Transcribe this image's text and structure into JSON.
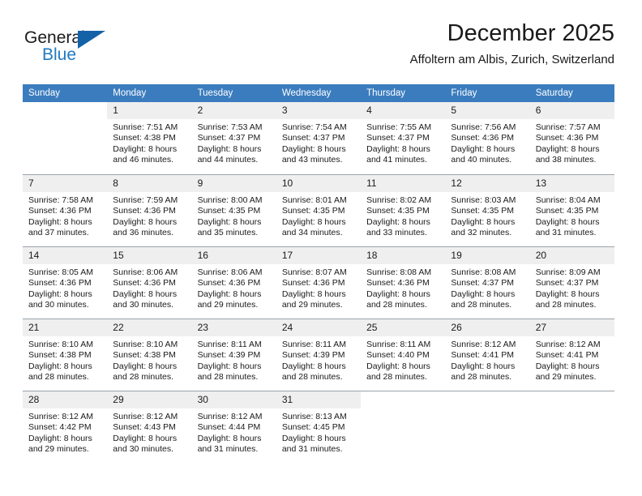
{
  "brand": {
    "name_top": "General",
    "name_bottom": "Blue",
    "triangle_color": "#1362a8",
    "blue_color": "#1f7ac0"
  },
  "header": {
    "month_title": "December 2025",
    "location": "Affoltern am Albis, Zurich, Switzerland"
  },
  "theme": {
    "header_row_bg": "#3b7cbe",
    "daynum_bg": "#efefef",
    "grid_line": "#9aa3ab",
    "text": "#1a1a1a"
  },
  "calendar": {
    "weekday_headers": [
      "Sunday",
      "Monday",
      "Tuesday",
      "Wednesday",
      "Thursday",
      "Friday",
      "Saturday"
    ],
    "weeks": [
      [
        {
          "day": "",
          "sunrise": "",
          "sunset": "",
          "daylight_line1": "",
          "daylight_line2": ""
        },
        {
          "day": "1",
          "sunrise": "Sunrise: 7:51 AM",
          "sunset": "Sunset: 4:38 PM",
          "daylight_line1": "Daylight: 8 hours",
          "daylight_line2": "and 46 minutes."
        },
        {
          "day": "2",
          "sunrise": "Sunrise: 7:53 AM",
          "sunset": "Sunset: 4:37 PM",
          "daylight_line1": "Daylight: 8 hours",
          "daylight_line2": "and 44 minutes."
        },
        {
          "day": "3",
          "sunrise": "Sunrise: 7:54 AM",
          "sunset": "Sunset: 4:37 PM",
          "daylight_line1": "Daylight: 8 hours",
          "daylight_line2": "and 43 minutes."
        },
        {
          "day": "4",
          "sunrise": "Sunrise: 7:55 AM",
          "sunset": "Sunset: 4:37 PM",
          "daylight_line1": "Daylight: 8 hours",
          "daylight_line2": "and 41 minutes."
        },
        {
          "day": "5",
          "sunrise": "Sunrise: 7:56 AM",
          "sunset": "Sunset: 4:36 PM",
          "daylight_line1": "Daylight: 8 hours",
          "daylight_line2": "and 40 minutes."
        },
        {
          "day": "6",
          "sunrise": "Sunrise: 7:57 AM",
          "sunset": "Sunset: 4:36 PM",
          "daylight_line1": "Daylight: 8 hours",
          "daylight_line2": "and 38 minutes."
        }
      ],
      [
        {
          "day": "7",
          "sunrise": "Sunrise: 7:58 AM",
          "sunset": "Sunset: 4:36 PM",
          "daylight_line1": "Daylight: 8 hours",
          "daylight_line2": "and 37 minutes."
        },
        {
          "day": "8",
          "sunrise": "Sunrise: 7:59 AM",
          "sunset": "Sunset: 4:36 PM",
          "daylight_line1": "Daylight: 8 hours",
          "daylight_line2": "and 36 minutes."
        },
        {
          "day": "9",
          "sunrise": "Sunrise: 8:00 AM",
          "sunset": "Sunset: 4:35 PM",
          "daylight_line1": "Daylight: 8 hours",
          "daylight_line2": "and 35 minutes."
        },
        {
          "day": "10",
          "sunrise": "Sunrise: 8:01 AM",
          "sunset": "Sunset: 4:35 PM",
          "daylight_line1": "Daylight: 8 hours",
          "daylight_line2": "and 34 minutes."
        },
        {
          "day": "11",
          "sunrise": "Sunrise: 8:02 AM",
          "sunset": "Sunset: 4:35 PM",
          "daylight_line1": "Daylight: 8 hours",
          "daylight_line2": "and 33 minutes."
        },
        {
          "day": "12",
          "sunrise": "Sunrise: 8:03 AM",
          "sunset": "Sunset: 4:35 PM",
          "daylight_line1": "Daylight: 8 hours",
          "daylight_line2": "and 32 minutes."
        },
        {
          "day": "13",
          "sunrise": "Sunrise: 8:04 AM",
          "sunset": "Sunset: 4:35 PM",
          "daylight_line1": "Daylight: 8 hours",
          "daylight_line2": "and 31 minutes."
        }
      ],
      [
        {
          "day": "14",
          "sunrise": "Sunrise: 8:05 AM",
          "sunset": "Sunset: 4:36 PM",
          "daylight_line1": "Daylight: 8 hours",
          "daylight_line2": "and 30 minutes."
        },
        {
          "day": "15",
          "sunrise": "Sunrise: 8:06 AM",
          "sunset": "Sunset: 4:36 PM",
          "daylight_line1": "Daylight: 8 hours",
          "daylight_line2": "and 30 minutes."
        },
        {
          "day": "16",
          "sunrise": "Sunrise: 8:06 AM",
          "sunset": "Sunset: 4:36 PM",
          "daylight_line1": "Daylight: 8 hours",
          "daylight_line2": "and 29 minutes."
        },
        {
          "day": "17",
          "sunrise": "Sunrise: 8:07 AM",
          "sunset": "Sunset: 4:36 PM",
          "daylight_line1": "Daylight: 8 hours",
          "daylight_line2": "and 29 minutes."
        },
        {
          "day": "18",
          "sunrise": "Sunrise: 8:08 AM",
          "sunset": "Sunset: 4:36 PM",
          "daylight_line1": "Daylight: 8 hours",
          "daylight_line2": "and 28 minutes."
        },
        {
          "day": "19",
          "sunrise": "Sunrise: 8:08 AM",
          "sunset": "Sunset: 4:37 PM",
          "daylight_line1": "Daylight: 8 hours",
          "daylight_line2": "and 28 minutes."
        },
        {
          "day": "20",
          "sunrise": "Sunrise: 8:09 AM",
          "sunset": "Sunset: 4:37 PM",
          "daylight_line1": "Daylight: 8 hours",
          "daylight_line2": "and 28 minutes."
        }
      ],
      [
        {
          "day": "21",
          "sunrise": "Sunrise: 8:10 AM",
          "sunset": "Sunset: 4:38 PM",
          "daylight_line1": "Daylight: 8 hours",
          "daylight_line2": "and 28 minutes."
        },
        {
          "day": "22",
          "sunrise": "Sunrise: 8:10 AM",
          "sunset": "Sunset: 4:38 PM",
          "daylight_line1": "Daylight: 8 hours",
          "daylight_line2": "and 28 minutes."
        },
        {
          "day": "23",
          "sunrise": "Sunrise: 8:11 AM",
          "sunset": "Sunset: 4:39 PM",
          "daylight_line1": "Daylight: 8 hours",
          "daylight_line2": "and 28 minutes."
        },
        {
          "day": "24",
          "sunrise": "Sunrise: 8:11 AM",
          "sunset": "Sunset: 4:39 PM",
          "daylight_line1": "Daylight: 8 hours",
          "daylight_line2": "and 28 minutes."
        },
        {
          "day": "25",
          "sunrise": "Sunrise: 8:11 AM",
          "sunset": "Sunset: 4:40 PM",
          "daylight_line1": "Daylight: 8 hours",
          "daylight_line2": "and 28 minutes."
        },
        {
          "day": "26",
          "sunrise": "Sunrise: 8:12 AM",
          "sunset": "Sunset: 4:41 PM",
          "daylight_line1": "Daylight: 8 hours",
          "daylight_line2": "and 28 minutes."
        },
        {
          "day": "27",
          "sunrise": "Sunrise: 8:12 AM",
          "sunset": "Sunset: 4:41 PM",
          "daylight_line1": "Daylight: 8 hours",
          "daylight_line2": "and 29 minutes."
        }
      ],
      [
        {
          "day": "28",
          "sunrise": "Sunrise: 8:12 AM",
          "sunset": "Sunset: 4:42 PM",
          "daylight_line1": "Daylight: 8 hours",
          "daylight_line2": "and 29 minutes."
        },
        {
          "day": "29",
          "sunrise": "Sunrise: 8:12 AM",
          "sunset": "Sunset: 4:43 PM",
          "daylight_line1": "Daylight: 8 hours",
          "daylight_line2": "and 30 minutes."
        },
        {
          "day": "30",
          "sunrise": "Sunrise: 8:12 AM",
          "sunset": "Sunset: 4:44 PM",
          "daylight_line1": "Daylight: 8 hours",
          "daylight_line2": "and 31 minutes."
        },
        {
          "day": "31",
          "sunrise": "Sunrise: 8:13 AM",
          "sunset": "Sunset: 4:45 PM",
          "daylight_line1": "Daylight: 8 hours",
          "daylight_line2": "and 31 minutes."
        },
        {
          "day": "",
          "sunrise": "",
          "sunset": "",
          "daylight_line1": "",
          "daylight_line2": ""
        },
        {
          "day": "",
          "sunrise": "",
          "sunset": "",
          "daylight_line1": "",
          "daylight_line2": ""
        },
        {
          "day": "",
          "sunrise": "",
          "sunset": "",
          "daylight_line1": "",
          "daylight_line2": ""
        }
      ]
    ]
  }
}
